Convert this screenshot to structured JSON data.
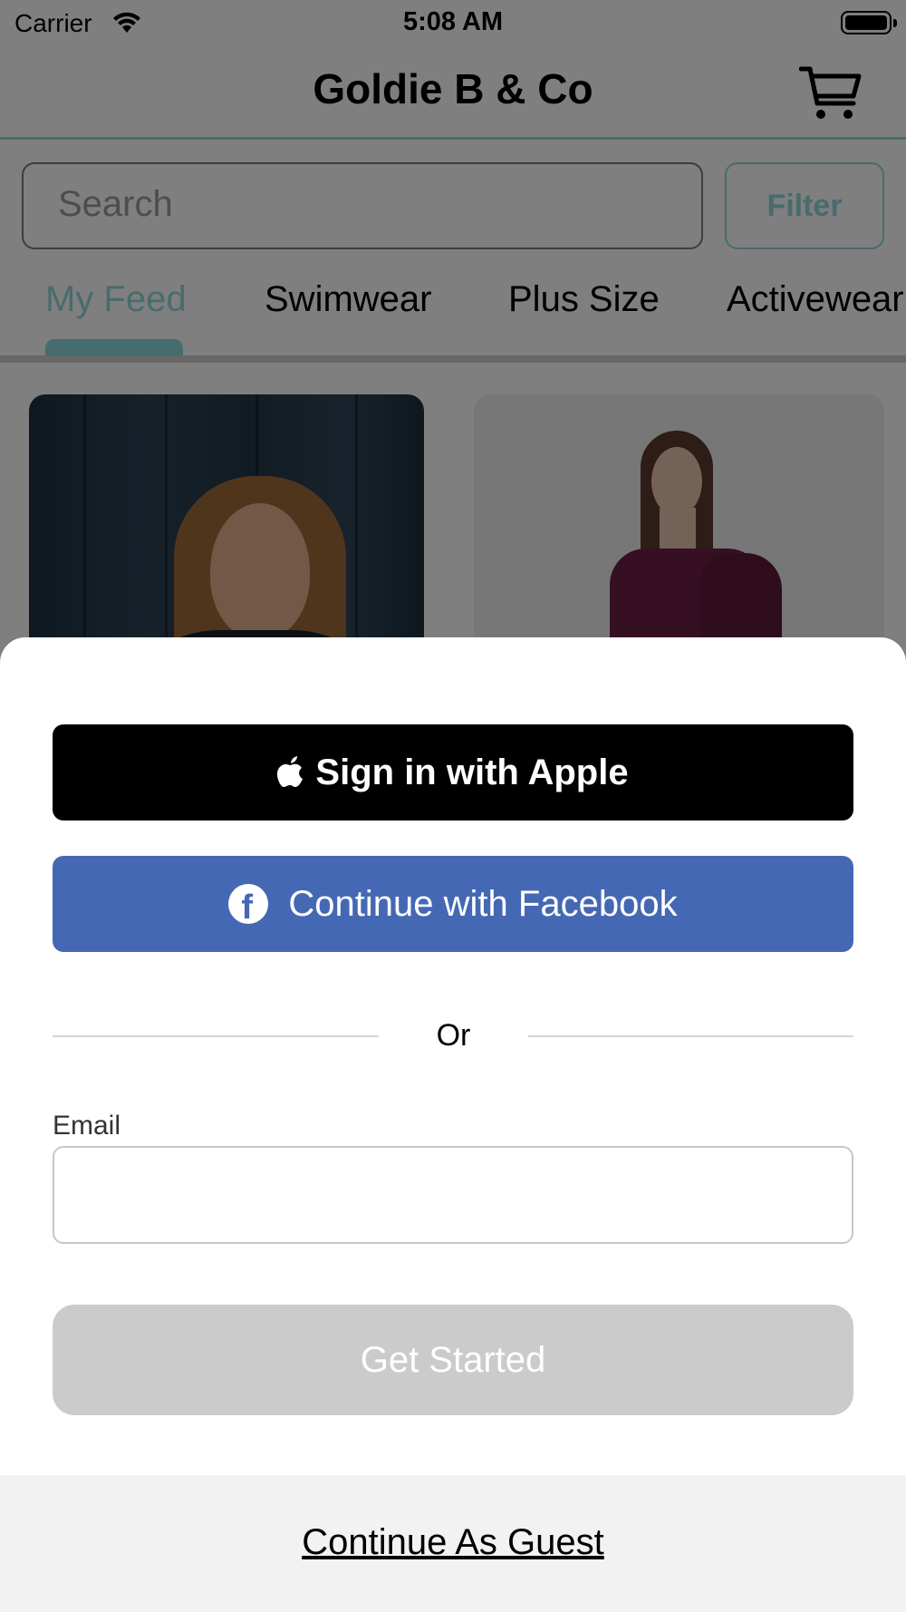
{
  "status_bar": {
    "carrier": "Carrier",
    "time": "5:08 AM",
    "wifi_icon": "wifi-icon",
    "battery_icon": "battery-icon"
  },
  "nav": {
    "title": "Goldie B & Co",
    "cart_icon": "cart-icon"
  },
  "search": {
    "placeholder": "Search",
    "filter_label": "Filter"
  },
  "tabs": [
    {
      "label": "My Feed",
      "active": true
    },
    {
      "label": "Swimwear",
      "active": false
    },
    {
      "label": "Plus Size",
      "active": false
    },
    {
      "label": "Activewear",
      "active": false
    }
  ],
  "colors": {
    "accent": "#8fd8db",
    "facebook": "#4468b3",
    "apple": "#000000",
    "disabled_button": "#cbcbcb"
  },
  "sheet": {
    "apple_button": {
      "label": "Sign in with Apple",
      "icon": "apple-logo-icon"
    },
    "facebook_button": {
      "label": "Continue with Facebook",
      "icon": "facebook-logo-icon"
    },
    "divider_text": "Or",
    "email_label": "Email",
    "email_value": "",
    "get_started_label": "Get Started",
    "guest_link": "Continue As Guest"
  }
}
